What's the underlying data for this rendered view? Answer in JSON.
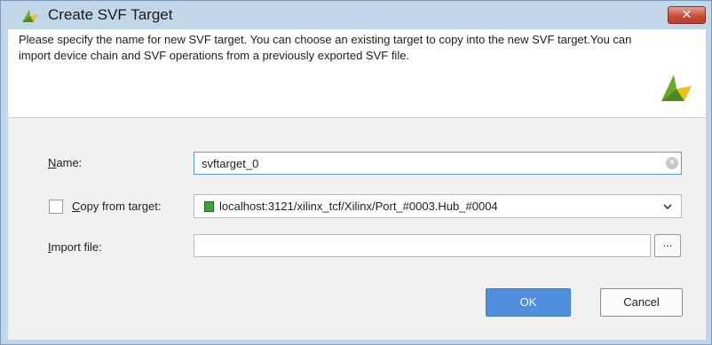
{
  "window": {
    "title": "Create SVF Target",
    "close_symbol": "✕"
  },
  "header": {
    "description": "Please specify the name for new SVF target. You can choose an existing target to copy into the new SVF target.You can import device chain and SVF operations from a previously exported SVF file."
  },
  "form": {
    "name": {
      "label_accel": "N",
      "label_rest": "ame:",
      "value": "svftarget_0",
      "clear_symbol": "×"
    },
    "copy_from_target": {
      "label_accel": "C",
      "label_rest": "opy from target:",
      "checked": false,
      "selected": "localhost:3121/xilinx_tcf/Xilinx/Port_#0003.Hub_#0004",
      "item_icon": "chip-icon",
      "chevron": "⌄"
    },
    "import_file": {
      "label_accel": "I",
      "label_rest": "mport file:",
      "value": "",
      "browse_label": "..."
    }
  },
  "buttons": {
    "ok": "OK",
    "cancel": "Cancel"
  },
  "colors": {
    "titlebar": "#c2d6ea",
    "close_button": "#c8503a",
    "primary_button": "#4f8fde",
    "focus_border": "#5b9bd5",
    "logo_green": "#6aaa2c",
    "logo_yellow": "#e8c320"
  }
}
